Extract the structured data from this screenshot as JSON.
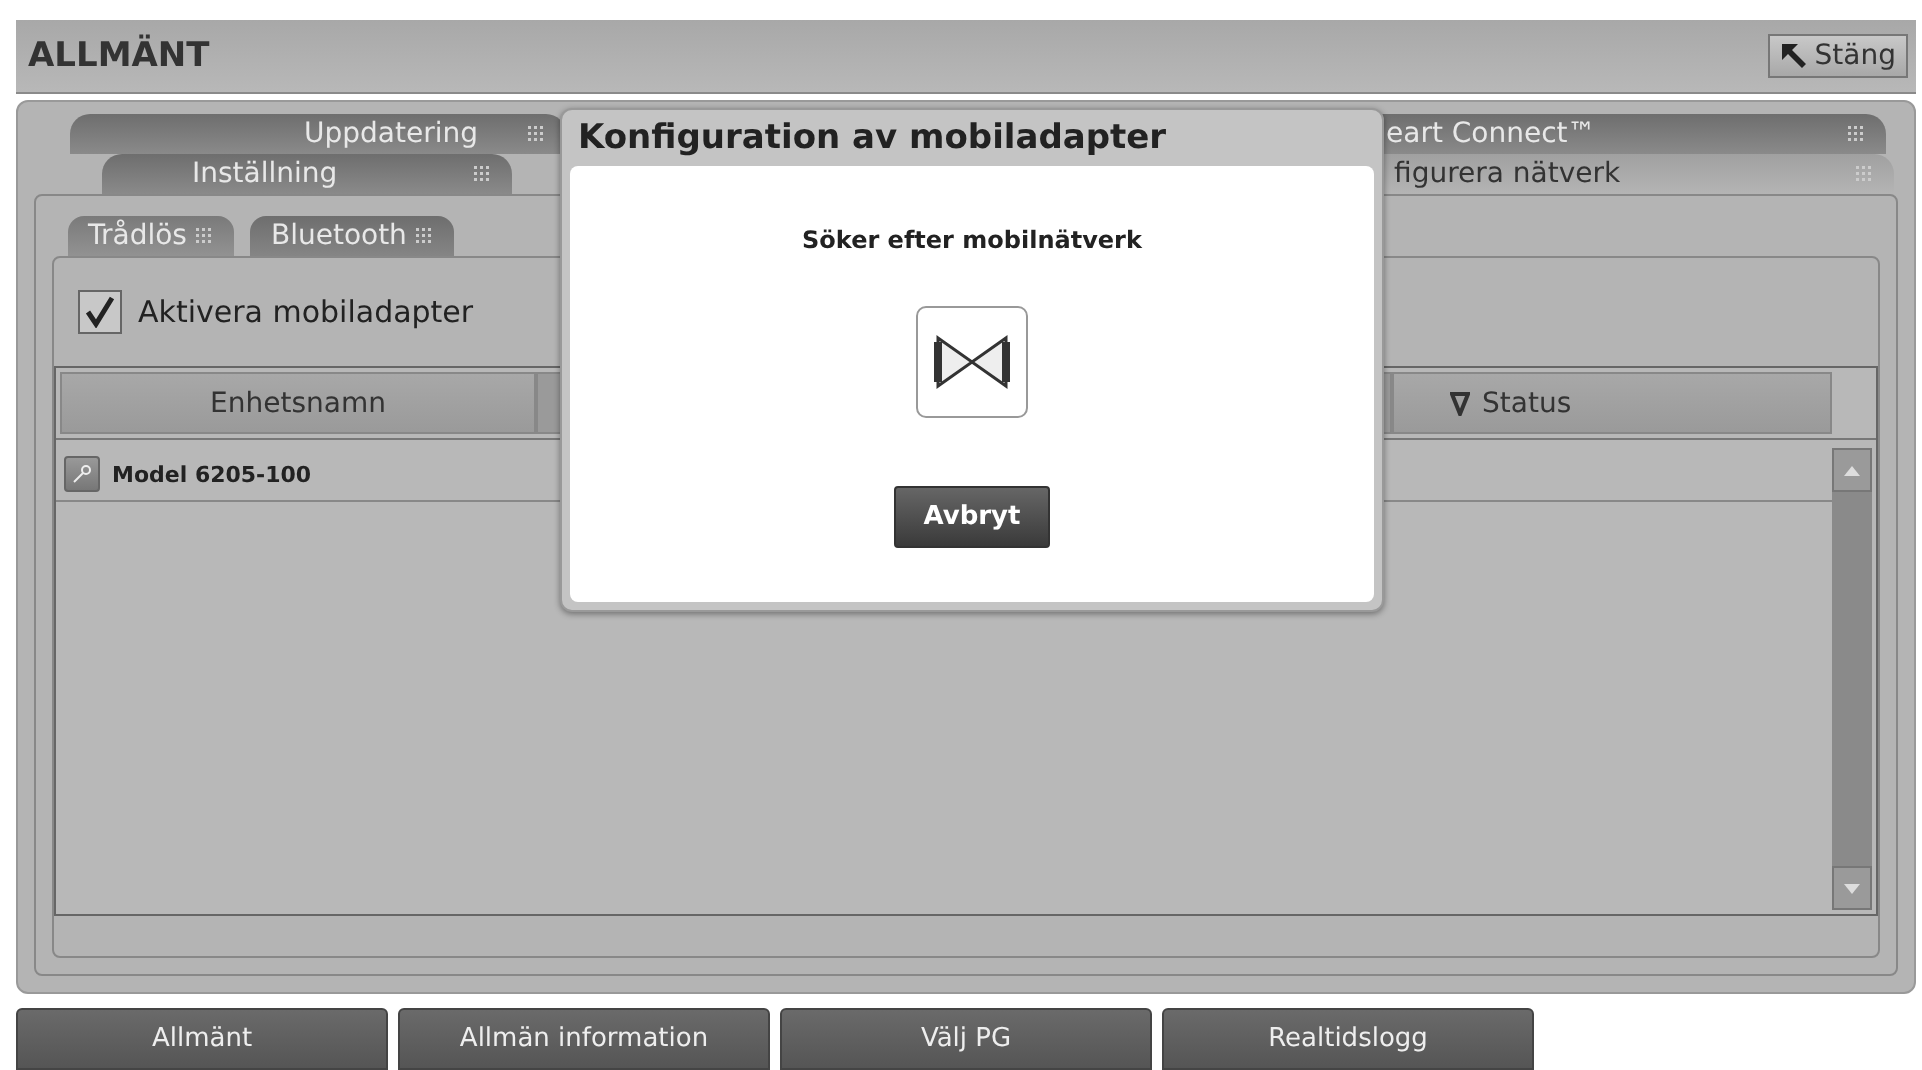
{
  "header": {
    "title": "ALLMÄNT",
    "close_button": "Stäng"
  },
  "tab_rows": [
    [
      {
        "label": "Uppdatering",
        "selected": false
      },
      {
        "label": "eart Connect™",
        "selected": false
      }
    ],
    [
      {
        "label": "Inställning",
        "selected": false
      },
      {
        "label": "figurera nätverk",
        "selected": true
      }
    ]
  ],
  "sub_tabs": [
    {
      "label": "Trådlös",
      "selected": true
    },
    {
      "label": "Bluetooth",
      "selected": false
    }
  ],
  "enable_checkbox": {
    "label": "Aktivera mobiladapter",
    "checked": true
  },
  "table": {
    "columns": [
      {
        "label": "Enhetsnamn",
        "sorted": false
      },
      {
        "label": "Status",
        "sorted": true
      }
    ],
    "rows": [
      {
        "name": "Model 6205-100"
      }
    ]
  },
  "dialog": {
    "title": "Konfiguration av mobiladapter",
    "message": "Söker efter mobilnätverk",
    "cancel_button": "Avbryt"
  },
  "bottom_nav": [
    "Allmänt",
    "Allmän information",
    "Välj PG",
    "Realtidslogg"
  ]
}
